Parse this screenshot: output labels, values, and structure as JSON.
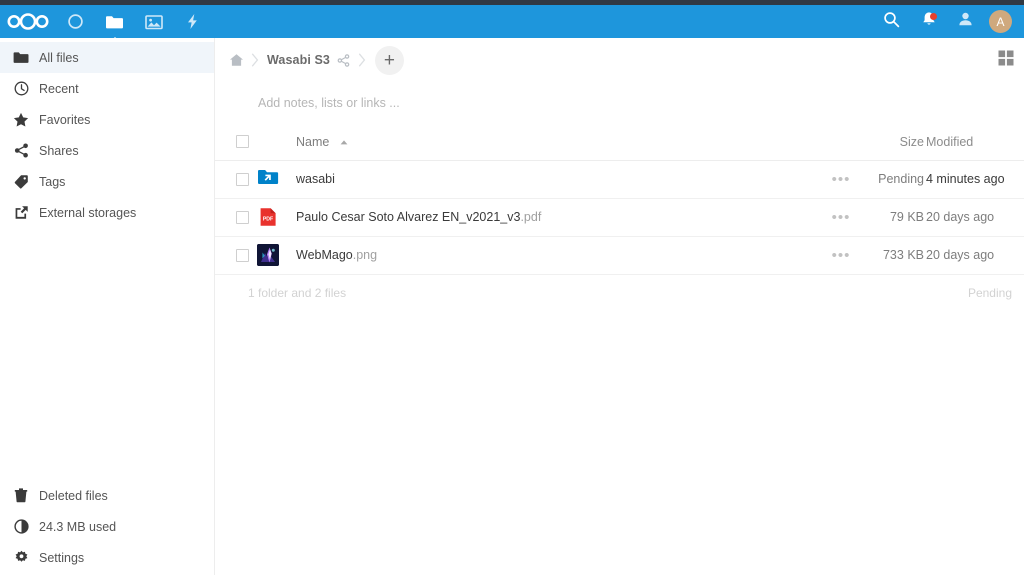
{
  "app": {
    "name": "Nextcloud",
    "logo_icon": "nextcloud-logo-icon",
    "accent_color": "#1e96dc",
    "topbar_color": "#313943"
  },
  "header": {
    "nav": [
      {
        "id": "dashboard",
        "icon": "circle-dashboard-icon",
        "label": "Dashboard",
        "active": false
      },
      {
        "id": "files",
        "icon": "folder-icon",
        "label": "Files",
        "active": true
      },
      {
        "id": "photos",
        "icon": "photos-icon",
        "label": "Photos",
        "active": false
      },
      {
        "id": "activity",
        "icon": "lightning-activity-icon",
        "label": "Activity",
        "active": false
      }
    ],
    "right": [
      {
        "id": "search",
        "icon": "search-icon",
        "label": "Search"
      },
      {
        "id": "notifications",
        "icon": "bell-icon",
        "label": "Notifications",
        "badge": true,
        "badge_color": "#e8402b"
      },
      {
        "id": "contacts",
        "icon": "contacts-icon",
        "label": "Contacts"
      }
    ],
    "avatar": {
      "initial": "A",
      "color": "#cfa97e",
      "label": "User menu"
    }
  },
  "sidebar": {
    "items": [
      {
        "icon": "folder-icon",
        "label": "All files",
        "active": true
      },
      {
        "icon": "clock-icon",
        "label": "Recent",
        "active": false
      },
      {
        "icon": "star-icon",
        "label": "Favorites",
        "active": false
      },
      {
        "icon": "share-icon",
        "label": "Shares",
        "active": false
      },
      {
        "icon": "tag-icon",
        "label": "Tags",
        "active": false
      },
      {
        "icon": "external-link-icon",
        "label": "External storages",
        "active": false
      }
    ],
    "bottom_items": [
      {
        "icon": "trash-icon",
        "label": "Deleted files"
      },
      {
        "icon": "quota-pie-icon",
        "label": "24.3 MB used"
      },
      {
        "icon": "gear-icon",
        "label": "Settings"
      }
    ]
  },
  "breadcrumb": {
    "home_icon": "home-icon",
    "separator_icon": "chevron-right-icon",
    "current": "Wasabi S3",
    "share_icon": "share-icon",
    "add_label": "+",
    "grid_toggle_icon": "grid-view-icon"
  },
  "notes": {
    "placeholder": "Add notes, lists or links ..."
  },
  "table": {
    "select_all_label": "",
    "columns": {
      "name": "Name",
      "size": "Size",
      "modified": "Modified"
    },
    "sort": {
      "column": "Name",
      "direction": "asc",
      "icon": "caret-up-icon"
    },
    "actions_icon": "ellipsis-icon",
    "rows": [
      {
        "icon": "external-folder-icon",
        "name": "wasabi",
        "ext": "",
        "size": "Pending",
        "modified": "4 minutes ago",
        "modified_recent": true,
        "actions": "•••"
      },
      {
        "icon": "pdf-file-icon",
        "name": "Paulo Cesar Soto Alvarez EN_v2021_v3",
        "ext": ".pdf",
        "size": "79 KB",
        "modified": "20 days ago",
        "modified_recent": false,
        "actions": "•••"
      },
      {
        "icon": "png-image-thumbnail",
        "name": "WebMago",
        "ext": ".png",
        "size": "733 KB",
        "modified": "20 days ago",
        "modified_recent": false,
        "actions": "•••"
      }
    ],
    "summary_left": "1 folder and 2 files",
    "summary_right": "Pending"
  }
}
